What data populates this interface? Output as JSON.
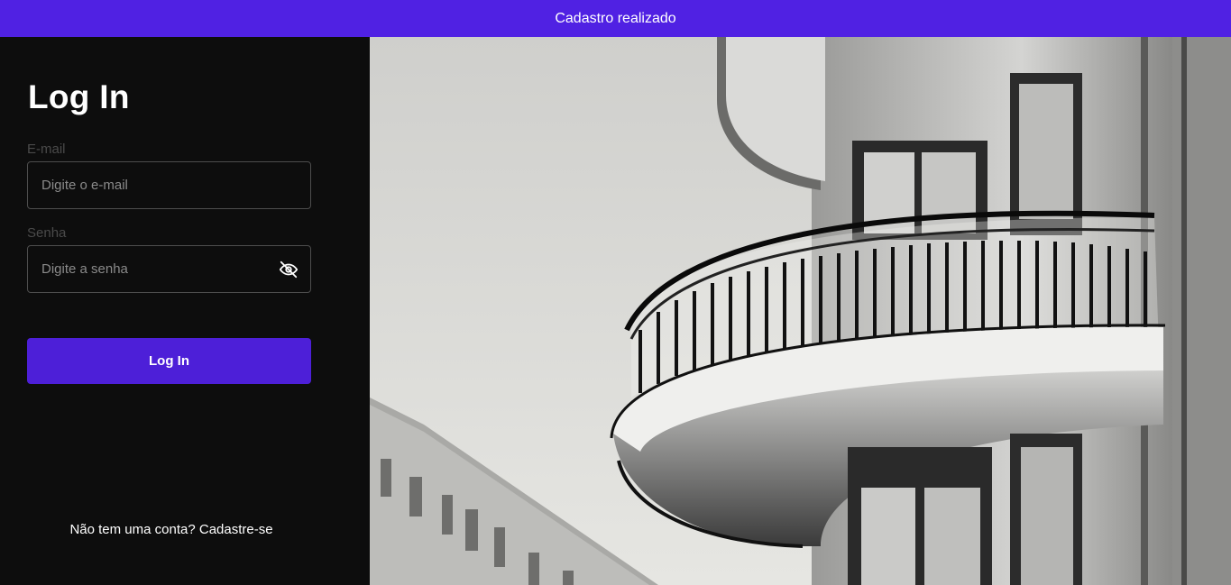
{
  "toast": {
    "message": "Cadastro realizado"
  },
  "login": {
    "title": "Log In",
    "email": {
      "label": "E-mail",
      "placeholder": "Digite o e-mail",
      "value": ""
    },
    "password": {
      "label": "Senha",
      "placeholder": "Digite a senha",
      "value": "",
      "toggle_icon": "eye-off-icon"
    },
    "submit_label": "Log In",
    "signup_prompt": "Não tem uma conta?",
    "signup_link": "Cadastre-se"
  },
  "colors": {
    "accent": "#4d1fd8",
    "toast_bg": "#5021e3",
    "panel_bg": "#0d0d0d"
  }
}
